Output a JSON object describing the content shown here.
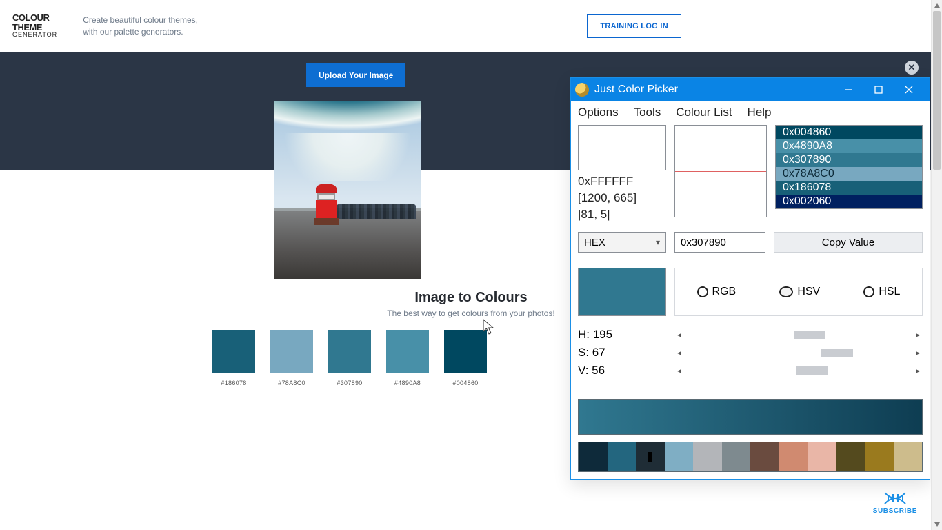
{
  "header": {
    "logo_l1": "COLOUR",
    "logo_l2": "THEME",
    "logo_l3": "GENERATOR",
    "tagline_l1": "Create beautiful colour themes,",
    "tagline_l2": "with our palette generators.",
    "training_login": "TRAINING LOG IN"
  },
  "band": {
    "upload_btn": "Upload Your Image"
  },
  "section": {
    "title": "Image to Colours",
    "subtitle": "The best way to get colours from your photos!"
  },
  "palette": [
    {
      "hex": "#186078",
      "label": "#186078"
    },
    {
      "hex": "#78A8C0",
      "label": "#78A8C0"
    },
    {
      "hex": "#307890",
      "label": "#307890"
    },
    {
      "hex": "#4890A8",
      "label": "#4890A8"
    },
    {
      "hex": "#004860",
      "label": "#004860"
    }
  ],
  "jcp": {
    "title": "Just Color Picker",
    "menu": {
      "options": "Options",
      "tools": "Tools",
      "colourlist": "Colour List",
      "help": "Help"
    },
    "sample_hex": "0xFFFFFF",
    "sample_coords": "[1200, 665]",
    "sample_delta": "|81, 5|",
    "history": [
      {
        "hex": "0x004860",
        "bg": "#004860"
      },
      {
        "hex": "0x4890A8",
        "bg": "#4890A8"
      },
      {
        "hex": "0x307890",
        "bg": "#307890"
      },
      {
        "hex": "0x78A8C0",
        "bg": "#78A8C0",
        "dark": true
      },
      {
        "hex": "0x186078",
        "bg": "#186078"
      },
      {
        "hex": "0x002060",
        "bg": "#002060"
      }
    ],
    "format_label": "HEX",
    "value_input": "0x307890",
    "copy_btn": "Copy Value",
    "big_swatch": "#307890",
    "modes": {
      "rgb": "RGB",
      "hsv": "HSV",
      "hsl": "HSL",
      "selected": "hsv"
    },
    "sliders": {
      "h": {
        "label": "H: 195",
        "pos": 48
      },
      "s": {
        "label": "S: 67",
        "pos": 60
      },
      "v": {
        "label": "V: 56",
        "pos": 49
      }
    },
    "grad_from": "#307890",
    "grad_to": "#0e3d52",
    "minis": [
      "#0e2a3a",
      "#23667f",
      "#1f2d36",
      "#7faec4",
      "#b3b5b9",
      "#7e8a8f",
      "#6a4b3f",
      "#d08a70",
      "#e9b6a7",
      "#544a1e",
      "#9a7a1e",
      "#cdbc8c"
    ],
    "mini_selected_index": 2
  },
  "subscribe_label": "SUBSCRIBE"
}
